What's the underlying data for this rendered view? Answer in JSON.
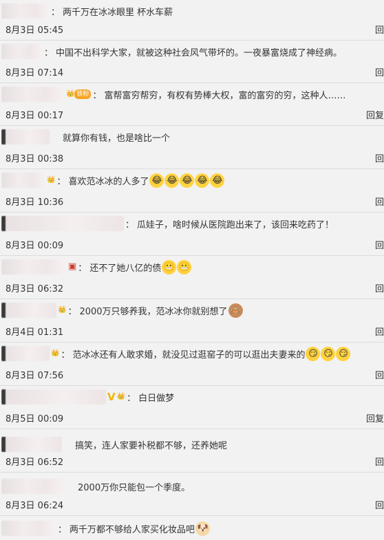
{
  "comments": [
    {
      "text": "两千万在冰冰眼里   杯水车薪",
      "time": "8月3日 05:45",
      "action": "回",
      "emoji": [],
      "badge": ""
    },
    {
      "text": "中国不出科学大家，就被这种社会风气带坏的。一夜暴富烧成了神经病。",
      "time": "8月3日 07:14",
      "action": "回",
      "emoji": [],
      "badge": ""
    },
    {
      "text": "富帮富穷帮穷，有权有势棒大权，富的富穷的穷，这种人……",
      "time": "8月3日 00:17",
      "action": "回复",
      "emoji": [],
      "badge": "铁粉"
    },
    {
      "text": "就算你有钱，也是啥比一个",
      "time": "8月3日 00:38",
      "action": "回",
      "emoji": [],
      "badge": ""
    },
    {
      "text": "喜欢范冰冰的人多了",
      "time": "8月3日 10:36",
      "action": "回",
      "emoji": [
        "laugh-cry",
        "laugh-cry",
        "laugh-cry",
        "laugh-cry",
        "laugh-cry"
      ],
      "badge": "👑"
    },
    {
      "text": "瓜娃子，啥时候从医院跑出来了，该回来吃药了！",
      "time": "8月3日 00:09",
      "action": "回",
      "emoji": [],
      "badge": ""
    },
    {
      "text": "还不了她八亿的债",
      "time": "8月3日 06:32",
      "action": "回",
      "emoji": [
        "grimace",
        "grimace"
      ],
      "badge": "▣"
    },
    {
      "text": "2000万只够养我，范冰冰你就别想了",
      "time": "8月4日 01:31",
      "action": "回",
      "emoji": [
        "monkey"
      ],
      "badge": "👑"
    },
    {
      "text": "范冰冰还有人敢求婚，就没见过逛窑子的可以逛出夫妻来的",
      "time": "8月3日 07:56",
      "action": "回",
      "emoji": [
        "smirk",
        "smirk",
        "smirk"
      ],
      "badge": "👑"
    },
    {
      "text": "白日做梦",
      "time": "8月5日 00:09",
      "action": "回复",
      "emoji": [],
      "badge": "V"
    },
    {
      "text": "搞笑，连人家要补税都不够，还养她呢",
      "time": "8月3日 06:52",
      "action": "回",
      "emoji": [],
      "badge": ""
    },
    {
      "text": "2000万你只能包一个季度。",
      "time": "8月3日 06:24",
      "action": "回",
      "emoji": [],
      "badge": ""
    },
    {
      "text": "两千万都不够给人家买化妆品吧",
      "time": "",
      "action": "",
      "emoji": [
        "doge"
      ],
      "badge": ""
    }
  ],
  "emoji_glyphs": {
    "laugh-cry": "😂",
    "grimace": "😬",
    "monkey": "🙈",
    "smirk": "😏",
    "doge": "🐶"
  },
  "colors": {
    "background": "#f2f2f2",
    "divider": "#dcdcdc",
    "text": "#333333",
    "badge_gold": "#f6a623"
  }
}
